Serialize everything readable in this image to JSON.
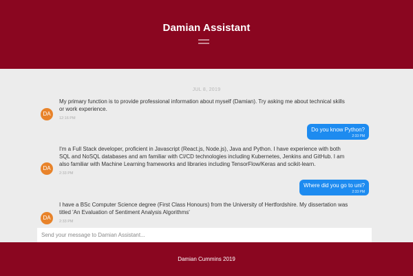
{
  "header": {
    "title": "Damian Assistant",
    "menu_icon": "hamburger-icon"
  },
  "chat": {
    "date": "JUL 8, 2019",
    "bot_initials": "DA",
    "messages": [
      {
        "from": "bot",
        "text": "My primary function is to provide professional information about myself (Damian). Try asking me about technical skills or work experience.",
        "time": "12:16 PM"
      },
      {
        "from": "user",
        "text": "Do you know Python?",
        "time": "2:33 PM"
      },
      {
        "from": "bot",
        "text": "I'm a Full Stack developer, proficient in Javascript (React.js, Node.js), Java and Python. I have experience with both SQL and NoSQL databases and am familiar with CI/CD technologies including Kubernetes, Jenkins and GitHub. I am also familiar with Machine Learning frameworks and libraries including TensorFlow/Keras and scikit-learn.",
        "time": "2:33 PM"
      },
      {
        "from": "user",
        "text": "Where did you go to uni?",
        "time": "2:33 PM"
      },
      {
        "from": "bot",
        "text": "I have a BSc Computer Science degree (First Class Honours) from the University of Hertfordshire. My dissertation was titled 'An Evaluation of Sentiment Analysis Algorithms'",
        "time": "2:33 PM"
      }
    ]
  },
  "input": {
    "placeholder": "Send your message to Damian Assistant..."
  },
  "footer": {
    "text": "Damian Cummins 2019"
  },
  "colors": {
    "brand": "#8a0620",
    "user_bubble": "#1d8bf0",
    "avatar": "#e8832a",
    "background": "#ececec"
  }
}
